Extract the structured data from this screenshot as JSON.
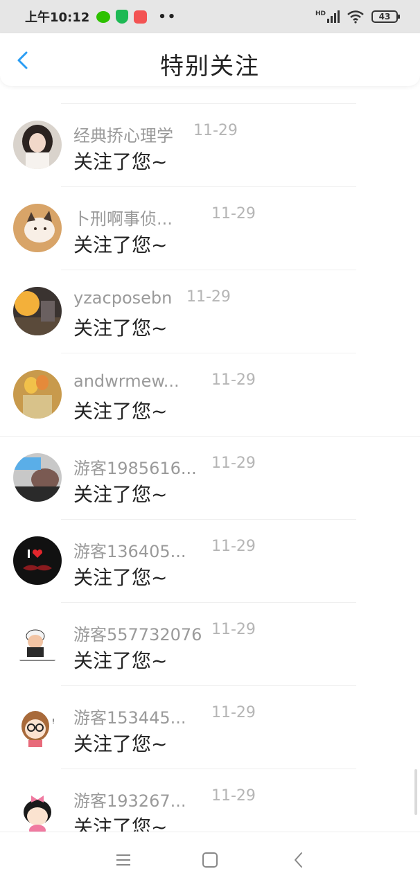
{
  "status_bar": {
    "time": "上午10:12",
    "dots": "••",
    "network_label": "HD",
    "battery": "43"
  },
  "header": {
    "title": "特别关注",
    "accent_color": "#2a9df4"
  },
  "notifications": [
    {
      "name": "经典挢心理学",
      "date": "11-29",
      "message": "关注了您~",
      "avatar": "girl-photo"
    },
    {
      "name": "卜刑啊事侦...",
      "date": "11-29",
      "message": "关注了您~",
      "avatar": "cat-photo"
    },
    {
      "name": "yzacposebn",
      "date": "11-29",
      "message": "关注了您~",
      "avatar": "sunset-photo"
    },
    {
      "name": "andwrmew...",
      "date": "11-29",
      "message": "关注了您~",
      "avatar": "balloons-photo"
    },
    {
      "name": "游客1985616...",
      "date": "11-29",
      "message": "关注了您~",
      "avatar": "legs-photo"
    },
    {
      "name": "游客136405...",
      "date": "11-29",
      "message": "关注了您~",
      "avatar": "i-love-moustache"
    },
    {
      "name": "游客557732076",
      "date": "11-29",
      "message": "关注了您~",
      "avatar": "cartoon-man"
    },
    {
      "name": "游客153445...",
      "date": "11-29",
      "message": "关注了您~",
      "avatar": "cartoon-girl-glasses"
    },
    {
      "name": "游客193267...",
      "date": "11-29",
      "message": "关注了您~",
      "avatar": "cartoon-girl-bow"
    }
  ]
}
